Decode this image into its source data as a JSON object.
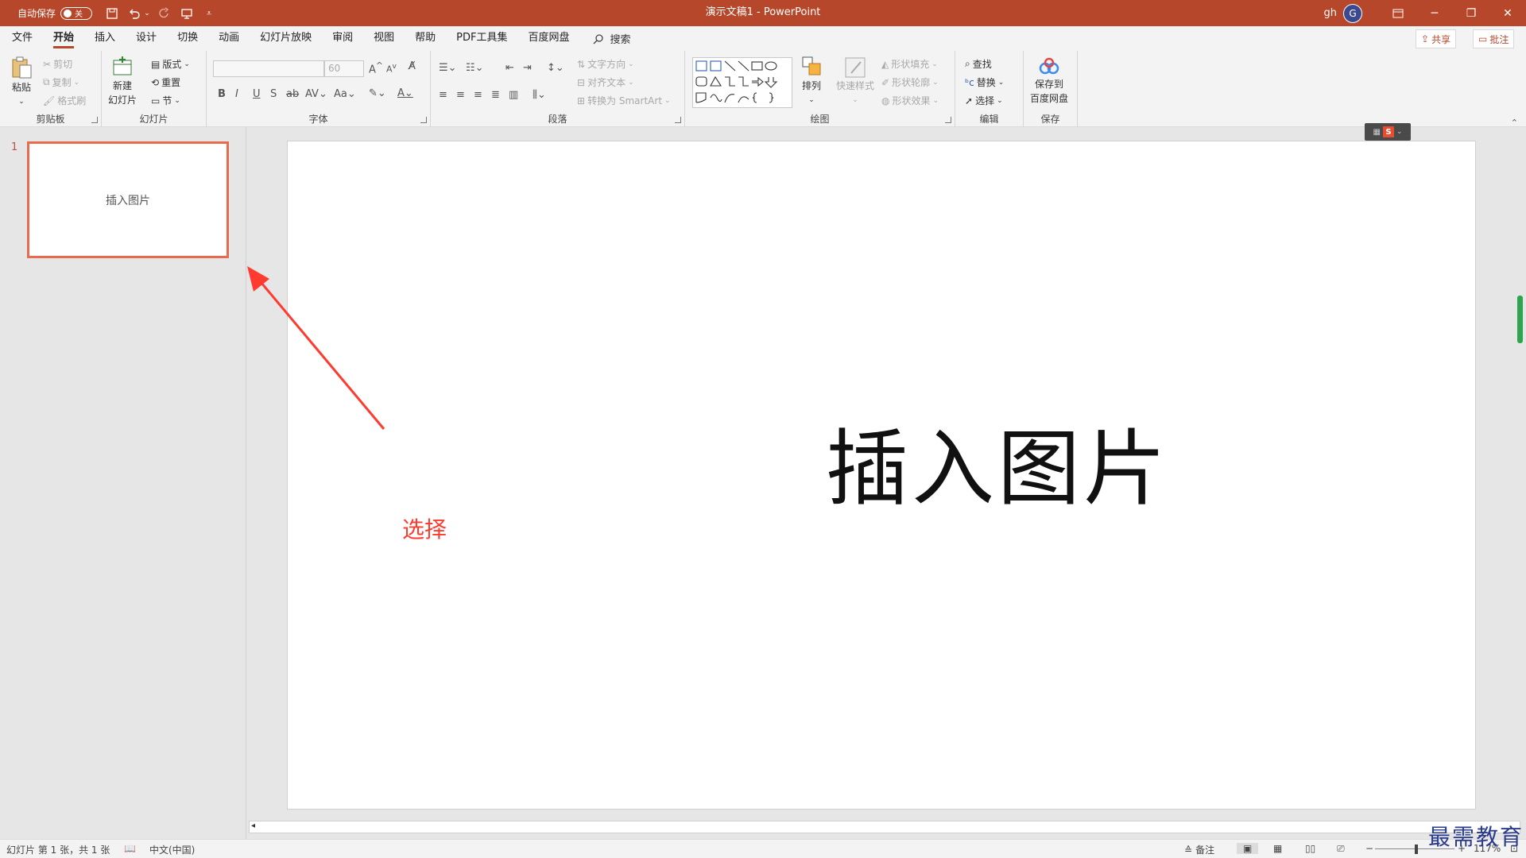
{
  "titlebar": {
    "autosave_label": "自动保存",
    "autosave_state": "关",
    "doc_title": "演示文稿1  -  PowerPoint",
    "user_initials": "gh",
    "avatar_letter": "G",
    "accent": "#b7472a"
  },
  "menu": {
    "tabs": [
      "文件",
      "开始",
      "插入",
      "设计",
      "切换",
      "动画",
      "幻灯片放映",
      "审阅",
      "视图",
      "帮助",
      "PDF工具集",
      "百度网盘"
    ],
    "active_tab": "开始",
    "search_label": "搜索",
    "share_label": "共享",
    "comments_label": "批注"
  },
  "ribbon": {
    "clipboard": {
      "paste": "粘贴",
      "cut": "剪切",
      "copy": "复制",
      "format_painter": "格式刷",
      "label": "剪贴板"
    },
    "slides": {
      "new_slide_line1": "新建",
      "new_slide_line2": "幻灯片",
      "layout": "版式",
      "reset": "重置",
      "section": "节",
      "label": "幻灯片"
    },
    "font": {
      "font_name": "",
      "font_size": "60",
      "label": "字体"
    },
    "paragraph": {
      "text_direction": "文字方向",
      "align_text": "对齐文本",
      "smartart": "转换为 SmartArt",
      "label": "段落"
    },
    "drawing": {
      "arrange": "排列",
      "quick_styles": "快速样式",
      "shape_fill": "形状填充",
      "shape_outline": "形状轮廓",
      "shape_effects": "形状效果",
      "label": "绘图"
    },
    "editing": {
      "find": "查找",
      "replace": "替换",
      "select": "选择",
      "label": "编辑"
    },
    "save": {
      "save_line1": "保存到",
      "save_line2": "百度网盘",
      "label": "保存"
    }
  },
  "slides_panel": {
    "slide_number": "1",
    "thumb_text": "插入图片"
  },
  "slide": {
    "title": "插入图片"
  },
  "annotation": {
    "text": "选择",
    "color": "#ff3b30"
  },
  "statusbar": {
    "slide_info": "幻灯片 第 1 张，共 1 张",
    "language": "中文(中国)",
    "notes": "备注",
    "zoom": "117%"
  },
  "watermark": "最需教育"
}
